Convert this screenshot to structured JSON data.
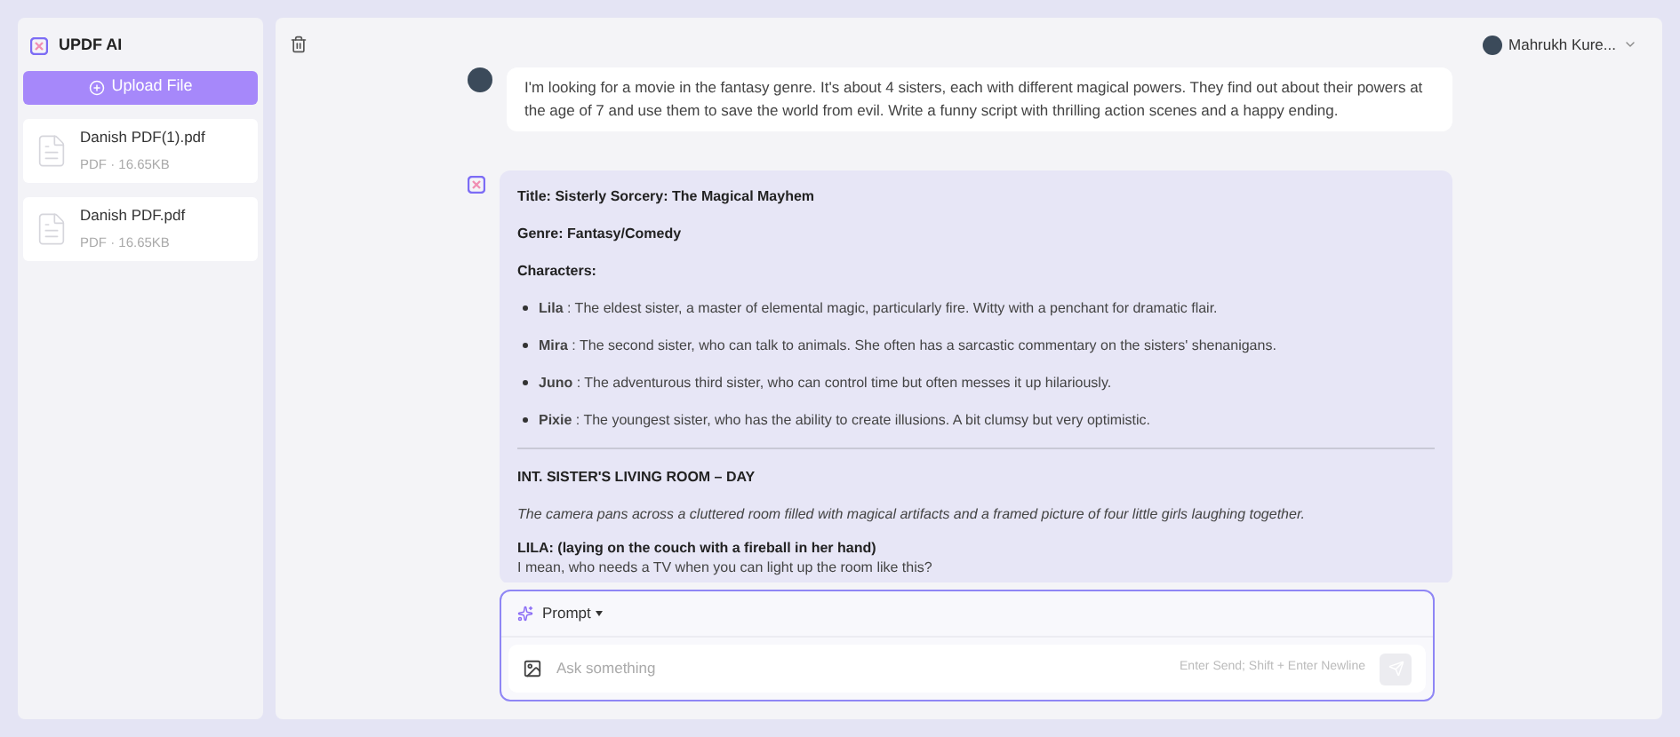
{
  "sidebar": {
    "app_title": "UPDF AI",
    "upload_button": "Upload File",
    "files": [
      {
        "name": "Danish PDF(1).pdf",
        "meta": "PDF · 16.65KB"
      },
      {
        "name": "Danish PDF.pdf",
        "meta": "PDF · 16.65KB"
      }
    ]
  },
  "header": {
    "user_name": "Mahrukh Kure..."
  },
  "messages": [
    {
      "kind": "user",
      "text": "I'm looking for a movie in the fantasy genre. It's about 4 sisters, each with different magical powers. They find out about their powers at the age of 7 and use them to save the world from evil. Write a funny script with thrilling action scenes and a happy ending."
    },
    {
      "kind": "ai",
      "blocks": [
        {
          "kind": "heading",
          "text": "Title: Sisterly Sorcery: The Magical Mayhem"
        },
        {
          "kind": "heading",
          "text": "Genre: Fantasy/Comedy"
        },
        {
          "kind": "heading",
          "text": "Characters:"
        },
        {
          "kind": "bullet",
          "text": "**Lila** : The eldest sister, a master of elemental magic, particularly fire. Witty with a penchant for dramatic flair."
        },
        {
          "kind": "bullet",
          "text": "**Mira** : The second sister, who can talk to animals. She often has a sarcastic commentary on the sisters' shenanigans."
        },
        {
          "kind": "bullet",
          "text": "**Juno** : The adventurous third sister, who can control time but often messes it up hilariously."
        },
        {
          "kind": "bullet",
          "text": "**Pixie** : The youngest sister, who has the ability to create illusions. A bit clumsy but very optimistic."
        },
        {
          "kind": "rule"
        },
        {
          "kind": "heading",
          "text": "INT. SISTER'S LIVING ROOM – DAY"
        },
        {
          "kind": "action",
          "text": "The camera pans across a cluttered room filled with magical artifacts and a framed picture of four little girls laughing together."
        },
        {
          "kind": "speaker",
          "text": "LILA: (laying on the couch with a fireball in her hand)"
        },
        {
          "kind": "line",
          "text": "I mean, who needs a TV when you can light up the room like this?"
        }
      ]
    }
  ],
  "composer": {
    "prompt_label": "Prompt",
    "placeholder": "Ask something",
    "hint": "Enter Send; Shift + Enter Newline"
  }
}
